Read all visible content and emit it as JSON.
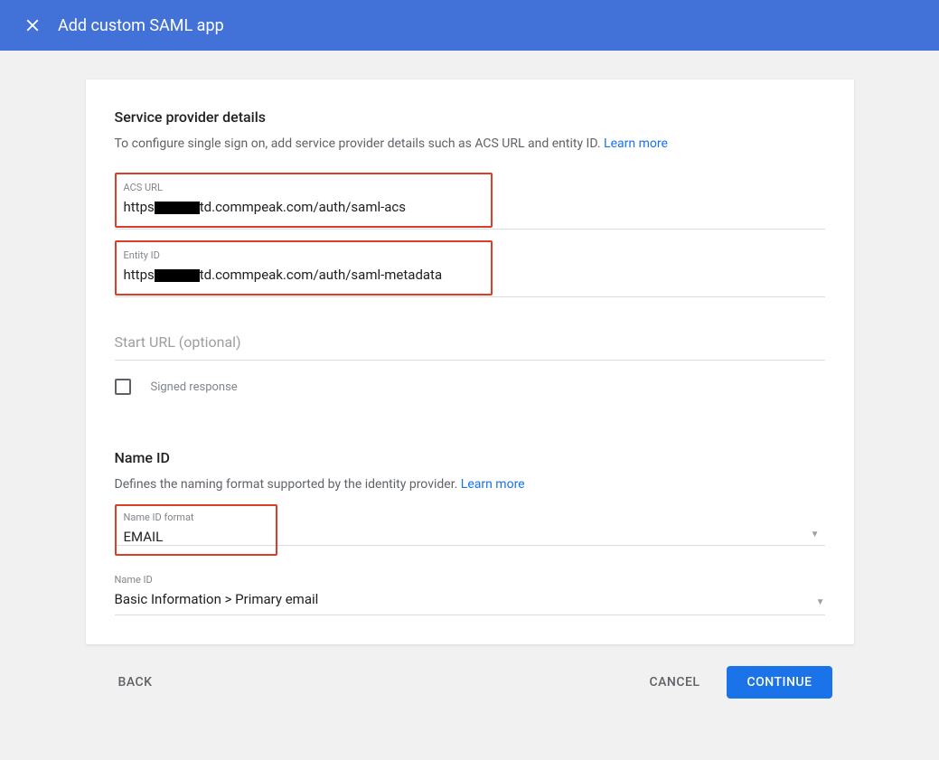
{
  "header": {
    "title": "Add custom SAML app"
  },
  "sp_details": {
    "title": "Service provider details",
    "desc": "To configure single sign on, add service provider details such as ACS URL and entity ID.",
    "learn_more": "Learn more",
    "acs_url_label": "ACS URL",
    "acs_url_prefix": "https",
    "acs_url_suffix": "td.commpeak.com/auth/saml-acs",
    "entity_id_label": "Entity ID",
    "entity_id_prefix": "https",
    "entity_id_suffix": "td.commpeak.com/auth/saml-metadata",
    "start_url_placeholder": "Start URL (optional)",
    "signed_response_label": "Signed response"
  },
  "name_id": {
    "title": "Name ID",
    "desc": "Defines the naming format supported by the identity provider.",
    "learn_more": "Learn more",
    "format_label": "Name ID format",
    "format_value": "EMAIL",
    "name_id_label": "Name ID",
    "name_id_value": "Basic Information > Primary email"
  },
  "footer": {
    "back": "BACK",
    "cancel": "CANCEL",
    "continue": "CONTINUE"
  }
}
